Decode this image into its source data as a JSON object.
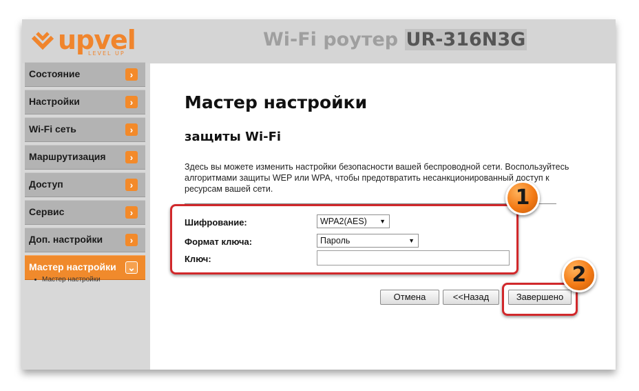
{
  "header": {
    "logo_text": "upvel",
    "logo_subtext": "LEVEL UP",
    "router_title": "Wi-Fi роутер",
    "router_model": "UR-316N3G"
  },
  "sidebar": {
    "items": [
      {
        "label": "Состояние",
        "icon": "chevron-right-icon"
      },
      {
        "label": "Настройки",
        "icon": "chevron-right-icon"
      },
      {
        "label": "Wi-Fi сеть",
        "icon": "chevron-right-icon"
      },
      {
        "label": "Маршрутизация",
        "icon": "chevron-right-icon"
      },
      {
        "label": "Доступ",
        "icon": "chevron-right-icon"
      },
      {
        "label": "Сервис",
        "icon": "chevron-right-icon"
      },
      {
        "label": "Доп. настройки",
        "icon": "chevron-right-icon"
      },
      {
        "label": "Мастер настройки",
        "icon": "chevron-down-icon",
        "active": true
      }
    ],
    "subitems": [
      "Мастер настройки"
    ]
  },
  "main": {
    "title": "Мастер настройки",
    "subtitle": "защиты Wi-Fi",
    "description": "Здесь вы можете изменить настройки безопасности вашей беспроводной сети. Воспользуйтесь алгоритмами защиты WEP или WPA, чтобы предотвратить несанкционированный доступ к ресурсам вашей сети.",
    "form": {
      "encryption_label": "Шифрование:",
      "encryption_value": "WPA2(AES)",
      "key_format_label": "Формат ключа:",
      "key_format_value": "Пароль",
      "key_label": "Ключ:",
      "key_value": ""
    },
    "buttons": {
      "cancel": "Отмена",
      "back": "<<Назад",
      "finish": "Завершено"
    }
  },
  "annotations": {
    "badge_1": "1",
    "badge_2": "2",
    "highlight_color": "#d1282b",
    "badge_color": "#f37a15"
  },
  "colors": {
    "accent": "#f08a2c",
    "nav_bg": "#b3b3b3"
  }
}
